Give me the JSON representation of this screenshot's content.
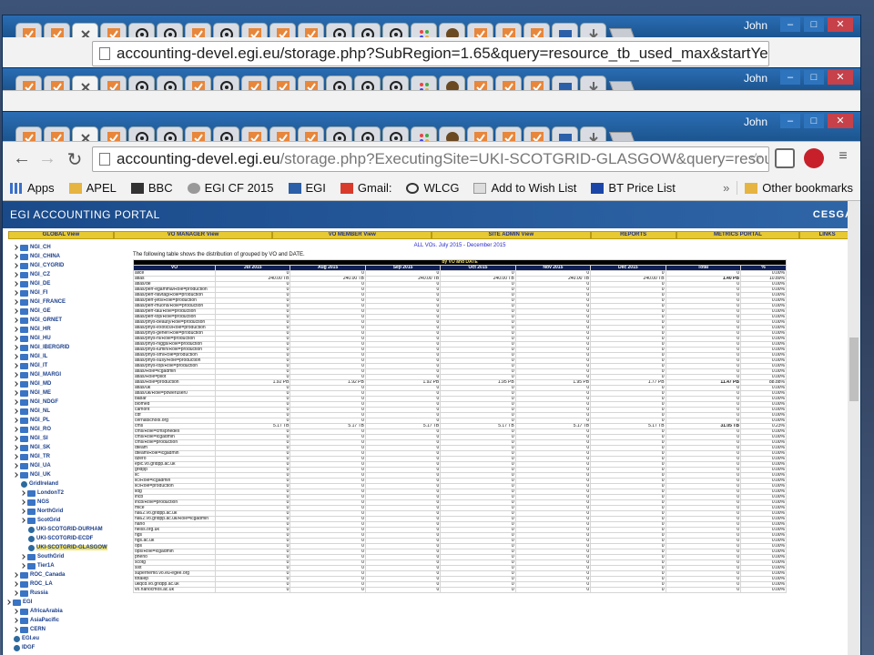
{
  "user": "John",
  "back_url": "accounting-devel.egi.eu/storage.php?SubRegion=1.65&query=resource_tb_used_max&startYe",
  "url_host": "accounting-devel.egi.eu",
  "url_path": "/storage.php?ExecutingSite=UKI-SCOTGRID-GLASGOW&query=resourc",
  "bookmarks": [
    "Apps",
    "APEL",
    "BBC",
    "EGI CF 2015",
    "EGI",
    "Gmail:",
    "WLCG",
    "Add to Wish List",
    "BT Price List"
  ],
  "bookmarks_overflow": "»",
  "other_bookmarks": "Other bookmarks",
  "portal_title": "EGI ACCOUNTING PORTAL",
  "portal_logo": "CESGA",
  "menu": [
    "GLOBAL View",
    "VO MANAGER View",
    "VO MEMBER View",
    "SITE ADMIN View",
    "REPORTS",
    "METRICS PORTAL",
    "LINKS"
  ],
  "subtitle": "ALL VOs. July 2015 - December 2015",
  "description": "The following table shows the distribution of grouped by VO and DATE.",
  "caption": "by VO and DATE",
  "columns": [
    "VO",
    "Jul 2015",
    "Aug 2015",
    "Sep 2015",
    "Oct 2015",
    "Nov 2015",
    "Dec 2015",
    "Total",
    "%"
  ],
  "rows": [
    [
      "alice",
      "0",
      "0",
      "0",
      "0",
      "0",
      "0",
      "0",
      "0.00%"
    ],
    [
      "atlas",
      "240.00 TB",
      "240.00 TB",
      "240.00 TB",
      "240.00 TB",
      "240.00 TB",
      "240.00 TB",
      "1.40 PB",
      "10.89%"
    ],
    [
      "atlas/de",
      "0",
      "0",
      "0",
      "0",
      "0",
      "0",
      "0",
      "0.00%"
    ],
    [
      "atlas/perf-egamma/Role=production",
      "0",
      "0",
      "0",
      "0",
      "0",
      "0",
      "0",
      "0.00%"
    ],
    [
      "atlas/perf-flavtag/Role=production",
      "0",
      "0",
      "0",
      "0",
      "0",
      "0",
      "0",
      "0.00%"
    ],
    [
      "atlas/perf-jets/Role=production",
      "0",
      "0",
      "0",
      "0",
      "0",
      "0",
      "0",
      "0.00%"
    ],
    [
      "atlas/perf-muons/Role=production",
      "0",
      "0",
      "0",
      "0",
      "0",
      "0",
      "0",
      "0.00%"
    ],
    [
      "atlas/perf-tau/Role=production",
      "0",
      "0",
      "0",
      "0",
      "0",
      "0",
      "0",
      "0.00%"
    ],
    [
      "atlas/perf-top/Role=production",
      "0",
      "0",
      "0",
      "0",
      "0",
      "0",
      "0",
      "0.00%"
    ],
    [
      "atlas/phys-beauty/Role=production",
      "0",
      "0",
      "0",
      "0",
      "0",
      "0",
      "0",
      "0.00%"
    ],
    [
      "atlas/phys-exotics/Role=production",
      "0",
      "0",
      "0",
      "0",
      "0",
      "0",
      "0",
      "0.00%"
    ],
    [
      "atlas/phys-gener/Role=production",
      "0",
      "0",
      "0",
      "0",
      "0",
      "0",
      "0",
      "0.00%"
    ],
    [
      "atlas/phys-hi/Role=production",
      "0",
      "0",
      "0",
      "0",
      "0",
      "0",
      "0",
      "0.00%"
    ],
    [
      "atlas/phys-higgs/Role=production",
      "0",
      "0",
      "0",
      "0",
      "0",
      "0",
      "0",
      "0.00%"
    ],
    [
      "atlas/phys-lumin/Role=production",
      "0",
      "0",
      "0",
      "0",
      "0",
      "0",
      "0",
      "0.00%"
    ],
    [
      "atlas/phys-sm/Role=production",
      "0",
      "0",
      "0",
      "0",
      "0",
      "0",
      "0",
      "0.00%"
    ],
    [
      "atlas/phys-susy/Role=production",
      "0",
      "0",
      "0",
      "0",
      "0",
      "0",
      "0",
      "0.00%"
    ],
    [
      "atlas/phys-top/Role=production",
      "0",
      "0",
      "0",
      "0",
      "0",
      "0",
      "0",
      "0.00%"
    ],
    [
      "atlas/Role=lcgadmin",
      "0",
      "0",
      "0",
      "0",
      "0",
      "0",
      "0",
      "0.00%"
    ],
    [
      "atlas/Role=pilot",
      "0",
      "0",
      "0",
      "0",
      "0",
      "0",
      "0",
      "0.00%"
    ],
    [
      "atlas/Role=production",
      "1.92 PB",
      "1.92 PB",
      "1.92 PB",
      "1.95 PB",
      "1.95 PB",
      "1.77 PB",
      "11.47 PB",
      "88.88%"
    ],
    [
      "atlas/uk",
      "0",
      "0",
      "0",
      "0",
      "0",
      "0",
      "0",
      "0.00%"
    ],
    [
      "atlas/uk/Role=poweruser0",
      "0",
      "0",
      "0",
      "0",
      "0",
      "0",
      "0",
      "0.00%"
    ],
    [
      "babar",
      "0",
      "0",
      "0",
      "0",
      "0",
      "0",
      "0",
      "0.00%"
    ],
    [
      "biomed",
      "0",
      "0",
      "0",
      "0",
      "0",
      "0",
      "0",
      "0.00%"
    ],
    [
      "camont",
      "0",
      "0",
      "0",
      "0",
      "0",
      "0",
      "0",
      "0.00%"
    ],
    [
      "cdf",
      "0",
      "0",
      "0",
      "0",
      "0",
      "0",
      "0",
      "0.00%"
    ],
    [
      "cernatschool.org",
      "0",
      "0",
      "0",
      "0",
      "0",
      "0",
      "0",
      "0.00%"
    ],
    [
      "cms",
      "5.17 TB",
      "5.17 TB",
      "5.17 TB",
      "5.17 TB",
      "5.17 TB",
      "5.17 TB",
      "31.05 TB",
      "0.23%"
    ],
    [
      "cms/Role=cmsphedex",
      "0",
      "0",
      "0",
      "0",
      "0",
      "0",
      "0",
      "0.00%"
    ],
    [
      "cms/Role=lcgadmin",
      "0",
      "0",
      "0",
      "0",
      "0",
      "0",
      "0",
      "0.00%"
    ],
    [
      "cms/Role=production",
      "0",
      "0",
      "0",
      "0",
      "0",
      "0",
      "0",
      "0.00%"
    ],
    [
      "dteam",
      "0",
      "0",
      "0",
      "0",
      "0",
      "0",
      "0",
      "0.00%"
    ],
    [
      "dteam/Role=lcgadmin",
      "0",
      "0",
      "0",
      "0",
      "0",
      "0",
      "0",
      "0.00%"
    ],
    [
      "dzero",
      "0",
      "0",
      "0",
      "0",
      "0",
      "0",
      "0",
      "0.00%"
    ],
    [
      "epic.vo.gridpp.ac.uk",
      "0",
      "0",
      "0",
      "0",
      "0",
      "0",
      "0",
      "0.00%"
    ],
    [
      "gridpp",
      "0",
      "0",
      "0",
      "0",
      "0",
      "0",
      "0",
      "0.00%"
    ],
    [
      "ilc",
      "0",
      "0",
      "0",
      "0",
      "0",
      "0",
      "0",
      "0.00%"
    ],
    [
      "ilc/Role=lcgadmin",
      "0",
      "0",
      "0",
      "0",
      "0",
      "0",
      "0",
      "0.00%"
    ],
    [
      "ilc/Role=production",
      "0",
      "0",
      "0",
      "0",
      "0",
      "0",
      "0",
      "0.00%"
    ],
    [
      "ildg",
      "0",
      "0",
      "0",
      "0",
      "0",
      "0",
      "0",
      "0.00%"
    ],
    [
      "lhcb",
      "0",
      "0",
      "0",
      "0",
      "0",
      "0",
      "0",
      "0.00%"
    ],
    [
      "lhcb/Role=production",
      "0",
      "0",
      "0",
      "0",
      "0",
      "0",
      "0",
      "0.00%"
    ],
    [
      "mice",
      "0",
      "0",
      "0",
      "0",
      "0",
      "0",
      "0",
      "0.00%"
    ],
    [
      "na62.vo.gridpp.ac.uk",
      "0",
      "0",
      "0",
      "0",
      "0",
      "0",
      "0",
      "0.00%"
    ],
    [
      "na62.vo.gridpp.ac.uk/Role=lcgadmin",
      "0",
      "0",
      "0",
      "0",
      "0",
      "0",
      "0",
      "0.00%"
    ],
    [
      "nano",
      "0",
      "0",
      "0",
      "0",
      "0",
      "0",
      "0",
      "0.00%"
    ],
    [
      "neiss.org.uk",
      "0",
      "0",
      "0",
      "0",
      "0",
      "0",
      "0",
      "0.00%"
    ],
    [
      "ngs",
      "0",
      "0",
      "0",
      "0",
      "0",
      "0",
      "0",
      "0.00%"
    ],
    [
      "ngs.ac.uk",
      "0",
      "0",
      "0",
      "0",
      "0",
      "0",
      "0",
      "0.00%"
    ],
    [
      "ops",
      "0",
      "0",
      "0",
      "0",
      "0",
      "0",
      "0",
      "0.00%"
    ],
    [
      "ops/Role=lcgadmin",
      "0",
      "0",
      "0",
      "0",
      "0",
      "0",
      "0",
      "0.00%"
    ],
    [
      "pheno",
      "0",
      "0",
      "0",
      "0",
      "0",
      "0",
      "0",
      "0.00%"
    ],
    [
      "scotg",
      "0",
      "0",
      "0",
      "0",
      "0",
      "0",
      "0",
      "0.00%"
    ],
    [
      "sixt",
      "0",
      "0",
      "0",
      "0",
      "0",
      "0",
      "0",
      "0.00%"
    ],
    [
      "supernemo.vo.eu-egee.org",
      "0",
      "0",
      "0",
      "0",
      "0",
      "0",
      "0",
      "0.00%"
    ],
    [
      "totalep",
      "0",
      "0",
      "0",
      "0",
      "0",
      "0",
      "0",
      "0.00%"
    ],
    [
      "ukqcd.vo.gridpp.ac.uk",
      "0",
      "0",
      "0",
      "0",
      "0",
      "0",
      "0",
      "0.00%"
    ],
    [
      "vo.nanocmos.ac.uk",
      "0",
      "0",
      "0",
      "0",
      "0",
      "0",
      "0",
      "0.00%"
    ]
  ],
  "tree": [
    {
      "label": "NGI_CH",
      "kind": "folder",
      "level": 1
    },
    {
      "label": "NGI_CHINA",
      "kind": "folder",
      "level": 1
    },
    {
      "label": "NGI_CYGRID",
      "kind": "folder",
      "level": 1
    },
    {
      "label": "NGI_CZ",
      "kind": "folder",
      "level": 1
    },
    {
      "label": "NGI_DE",
      "kind": "folder",
      "level": 1
    },
    {
      "label": "NGI_FI",
      "kind": "folder",
      "level": 1
    },
    {
      "label": "NGI_FRANCE",
      "kind": "folder",
      "level": 1
    },
    {
      "label": "NGI_GE",
      "kind": "folder",
      "level": 1
    },
    {
      "label": "NGI_GRNET",
      "kind": "folder",
      "level": 1
    },
    {
      "label": "NGI_HR",
      "kind": "folder",
      "level": 1
    },
    {
      "label": "NGI_HU",
      "kind": "folder",
      "level": 1
    },
    {
      "label": "NGI_IBERGRID",
      "kind": "folder",
      "level": 1
    },
    {
      "label": "NGI_IL",
      "kind": "folder",
      "level": 1
    },
    {
      "label": "NGI_IT",
      "kind": "folder",
      "level": 1
    },
    {
      "label": "NGI_MARGI",
      "kind": "folder",
      "level": 1
    },
    {
      "label": "NGI_MD",
      "kind": "folder",
      "level": 1
    },
    {
      "label": "NGI_ME",
      "kind": "folder",
      "level": 1
    },
    {
      "label": "NGI_NDGF",
      "kind": "folder",
      "level": 1
    },
    {
      "label": "NGI_NL",
      "kind": "folder",
      "level": 1
    },
    {
      "label": "NGI_PL",
      "kind": "folder",
      "level": 1
    },
    {
      "label": "NGI_RO",
      "kind": "folder",
      "level": 1
    },
    {
      "label": "NGI_SI",
      "kind": "folder",
      "level": 1
    },
    {
      "label": "NGI_SK",
      "kind": "folder",
      "level": 1
    },
    {
      "label": "NGI_TR",
      "kind": "folder",
      "level": 1
    },
    {
      "label": "NGI_UA",
      "kind": "folder",
      "level": 1
    },
    {
      "label": "NGI_UK",
      "kind": "folder",
      "level": 1
    },
    {
      "label": "GridIreland",
      "kind": "site",
      "level": 2
    },
    {
      "label": "LondonT2",
      "kind": "folder",
      "level": 2
    },
    {
      "label": "NGS",
      "kind": "folder",
      "level": 2
    },
    {
      "label": "NorthGrid",
      "kind": "folder",
      "level": 2
    },
    {
      "label": "ScotGrid",
      "kind": "folder",
      "level": 2
    },
    {
      "label": "UKI-SCOTGRID-DURHAM",
      "kind": "site",
      "level": 3
    },
    {
      "label": "UKI-SCOTGRID-ECDF",
      "kind": "site",
      "level": 3
    },
    {
      "label": "UKI-SCOTGRID-GLASGOW",
      "kind": "site",
      "level": 3,
      "selected": true
    },
    {
      "label": "SouthGrid",
      "kind": "folder",
      "level": 2
    },
    {
      "label": "Tier1A",
      "kind": "folder",
      "level": 2
    },
    {
      "label": "ROC_Canada",
      "kind": "folder",
      "level": 1
    },
    {
      "label": "ROC_LA",
      "kind": "folder",
      "level": 1
    },
    {
      "label": "Russia",
      "kind": "folder",
      "level": 1
    },
    {
      "label": "EGI",
      "kind": "folder",
      "level": 0
    },
    {
      "label": "AfricaArabia",
      "kind": "folder",
      "level": 1
    },
    {
      "label": "AsiaPacific",
      "kind": "folder",
      "level": 1
    },
    {
      "label": "CERN",
      "kind": "folder",
      "level": 1
    },
    {
      "label": "EGI.eu",
      "kind": "site",
      "level": 1
    },
    {
      "label": "IDGF",
      "kind": "site",
      "level": 1
    }
  ],
  "colors": {
    "window_frame": "#1a4f8a",
    "menu_button": "#e6c933",
    "table_header": "#0f1f55",
    "selected_tree": "#f3e46a",
    "link_blue": "#1a3e8c"
  }
}
